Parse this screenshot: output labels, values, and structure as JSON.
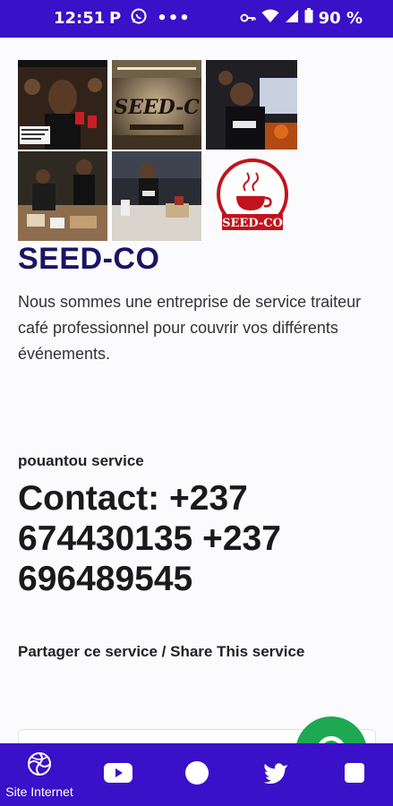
{
  "status_bar": {
    "time": "12:51",
    "icons_left": [
      "parking-icon",
      "whatsapp-icon",
      "more-dots-icon"
    ],
    "battery": "90 %"
  },
  "brand": {
    "title": "SEED-CO",
    "description": "Nous sommes une entreprise de service traiteur café professionnel pour couvrir vos différents événements.",
    "logo_text": "SEED-CO",
    "collage_text": "SEED-C"
  },
  "contact": {
    "label": "pouantou service",
    "text": "Contact: +237 674430135 +237 696489545"
  },
  "share": {
    "label": "Partager ce service / Share This service"
  },
  "bottom_nav": {
    "items": [
      {
        "label": "Site Internet",
        "icon": "globe-icon"
      },
      {
        "label": "",
        "icon": "youtube-icon"
      },
      {
        "label": "",
        "icon": "circle-icon"
      },
      {
        "label": "",
        "icon": "twitter-icon"
      },
      {
        "label": "",
        "icon": "square-icon"
      }
    ]
  },
  "colors": {
    "primary": "#3a10c8",
    "brand_title": "#1b1464",
    "fab": "#1da851",
    "logo_red": "#c0141c"
  }
}
